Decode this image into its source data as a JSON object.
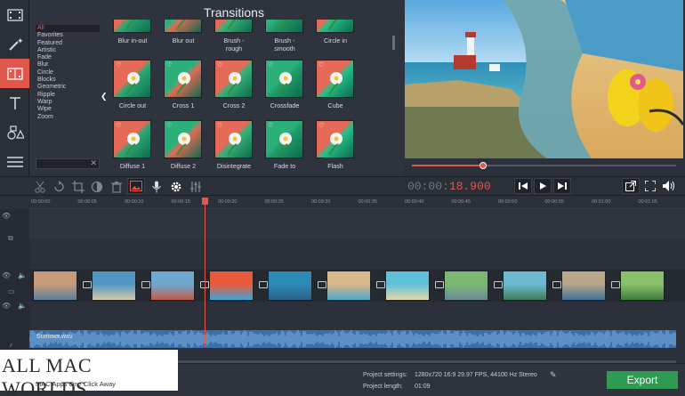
{
  "left_tools": [
    {
      "name": "import-media-icon"
    },
    {
      "name": "magic-wand-icon"
    },
    {
      "name": "transitions-filmstrip-icon"
    },
    {
      "name": "titles-text-icon"
    },
    {
      "name": "shapes-icon"
    },
    {
      "name": "list-menu-icon"
    }
  ],
  "transitions": {
    "title": "Transitions",
    "categories": [
      "All",
      "Favorites",
      "Featured",
      "Artistic",
      "Fade",
      "Blur",
      "Circle",
      "Blocks",
      "Geometric",
      "Ripple",
      "Warp",
      "Wipe",
      "Zoom"
    ],
    "selected_category": "All",
    "tiles": [
      {
        "label": "Blur in-out"
      },
      {
        "label": "Blur out"
      },
      {
        "label": "Brush -\nrough"
      },
      {
        "label": "Brush -\nsmooth"
      },
      {
        "label": "Circle in"
      },
      {
        "label": "Circle out"
      },
      {
        "label": "Cross 1"
      },
      {
        "label": "Cross 2"
      },
      {
        "label": "Crossfade"
      },
      {
        "label": "Cube"
      },
      {
        "label": "Diffuse 1"
      },
      {
        "label": "Diffuse 2"
      },
      {
        "label": "Disintegrate"
      },
      {
        "label": "Fade to"
      },
      {
        "label": "Flash"
      }
    ]
  },
  "player": {
    "timecode_dim": "00:00:",
    "timecode_active": "18.900",
    "progress": 0.27
  },
  "toolbar": {
    "tools": [
      "scissors-icon",
      "rotate-icon",
      "crop-icon",
      "color-adjust-icon",
      "trash-icon",
      "image-icon",
      "microphone-icon",
      "settings-gear-icon",
      "equalizer-icon"
    ],
    "playback": [
      "skip-back-icon",
      "play-icon",
      "skip-forward-icon"
    ],
    "right": [
      "export-window-icon",
      "fullscreen-icon",
      "volume-icon"
    ]
  },
  "ruler": [
    "00:00:00",
    "00:00:05",
    "00:00:10",
    "00:00:15",
    "00:00:20",
    "00:00:25",
    "00:00:30",
    "00:00:35",
    "00:00:40",
    "00:00:45",
    "00:00:50",
    "00:00:55",
    "00:01:00",
    "00:01:05"
  ],
  "audio_track": {
    "label": "Summer.wav"
  },
  "status": {
    "settings_label": "Project settings:",
    "settings_value": "1280x720 16:9 29.97 FPS, 44100 Hz Stereo",
    "length_label": "Project length:",
    "length_value": "01:09"
  },
  "export_label": "Export",
  "watermark": {
    "title": "ALL MAC WORLDS",
    "subtitle": "MAC Apps One Click Away"
  },
  "colors": {
    "accent": "#e2574c",
    "export_green": "#2e9a52",
    "audio_blue": "#3a6fa8",
    "panel": "#2e333d"
  }
}
